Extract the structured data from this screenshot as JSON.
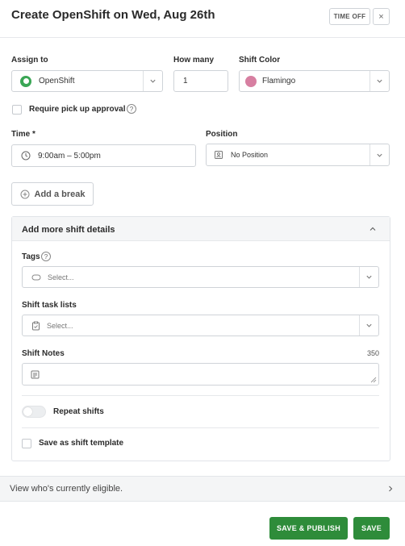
{
  "header": {
    "title": "Create OpenShift on Wed, Aug 26th",
    "time_off_label": "TIME OFF",
    "close_symbol": "×"
  },
  "assign_to": {
    "label": "Assign to",
    "value": "OpenShift",
    "icon_color": "#3aa655"
  },
  "how_many": {
    "label": "How many",
    "value": "1"
  },
  "shift_color": {
    "label": "Shift Color",
    "value": "Flamingo",
    "swatch": "#d77fa1"
  },
  "pickup_approval": {
    "label": "Require pick up approval",
    "help": "?"
  },
  "time": {
    "label": "Time *",
    "value": "9:00am – 5:00pm"
  },
  "position": {
    "label": "Position",
    "value": "No Position"
  },
  "add_break_label": "Add a break",
  "details": {
    "title": "Add more shift details",
    "tags": {
      "label": "Tags",
      "help": "?",
      "placeholder": "Select..."
    },
    "task_lists": {
      "label": "Shift task lists",
      "placeholder": "Select..."
    },
    "notes": {
      "label": "Shift Notes",
      "counter": "350"
    },
    "repeat_label": "Repeat shifts",
    "template_label": "Save as shift template"
  },
  "eligible_label": "View who's currently eligible.",
  "footer": {
    "save_publish": "SAVE & PUBLISH",
    "save": "SAVE",
    "accent": "#2e8c3a"
  }
}
